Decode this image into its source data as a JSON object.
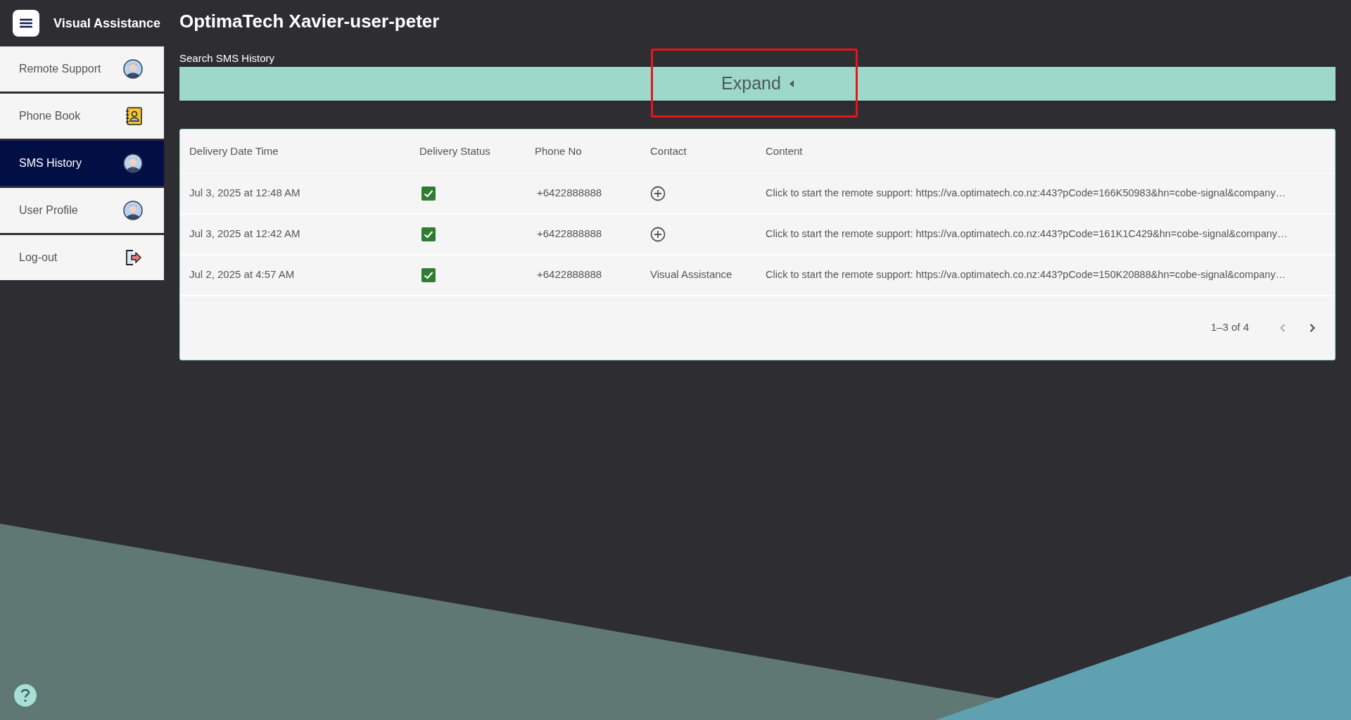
{
  "app": {
    "title": "Visual Assistance"
  },
  "sidebar": {
    "items": [
      {
        "label": "Remote Support",
        "kind": "avatar",
        "selected": false
      },
      {
        "label": "Phone Book",
        "kind": "phonebook",
        "selected": false
      },
      {
        "label": "SMS History",
        "kind": "avatar",
        "selected": true
      },
      {
        "label": "User Profile",
        "kind": "avatar",
        "selected": false
      },
      {
        "label": "Log-out",
        "kind": "logout",
        "selected": false
      }
    ]
  },
  "page": {
    "title": "OptimaTech Xavier-user-peter",
    "section_label": "Search SMS History",
    "expand_button": "Expand"
  },
  "table": {
    "columns": [
      "Delivery Date Time",
      "Delivery Status",
      "Phone No",
      "Contact",
      "Content"
    ],
    "rows": [
      {
        "date": "Jul 3, 2025 at 12:48 AM",
        "delivered": true,
        "phone": "+6422888888",
        "contact": {
          "kind": "add"
        },
        "content": "Click to start the remote support: https://va.optimatech.co.nz:443?pCode=166K50983&hn=cobe-signal&company…"
      },
      {
        "date": "Jul 3, 2025 at 12:42 AM",
        "delivered": true,
        "phone": "+6422888888",
        "contact": {
          "kind": "add"
        },
        "content": "Click to start the remote support: https://va.optimatech.co.nz:443?pCode=161K1C429&hn=cobe-signal&company…"
      },
      {
        "date": "Jul 2, 2025 at 4:57 AM",
        "delivered": true,
        "phone": "+6422888888",
        "contact": {
          "kind": "text",
          "text": "Visual Assistance"
        },
        "content": "Click to start the remote support: https://va.optimatech.co.nz:443?pCode=150K20888&hn=cobe-signal&company…"
      }
    ],
    "pagination": {
      "range": "1–3 of 4",
      "prev_disabled": true,
      "next_disabled": false
    }
  }
}
